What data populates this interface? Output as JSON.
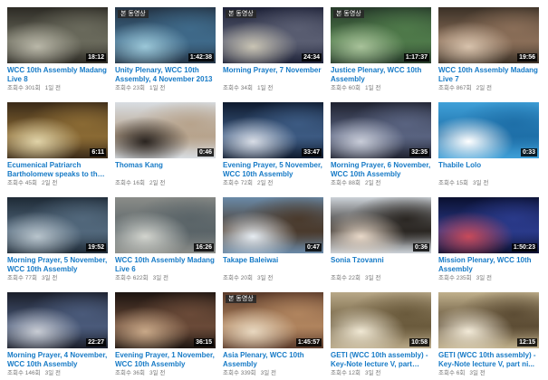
{
  "videos": [
    {
      "title": "WCC 10th Assembly Madang Live 8",
      "duration": "18:12",
      "views": "조회수 301회",
      "age": "1일 전",
      "badge": "",
      "palette": [
        "#2c2a24",
        "#6a6a5c",
        "#b9b7a8"
      ]
    },
    {
      "title": "Unity Plenary, WCC 10th Assembly, 4 November 2013",
      "duration": "1:42:38",
      "views": "조회수 23회",
      "age": "1일 전",
      "badge": "본 동영상",
      "palette": [
        "#243445",
        "#3f6a8a",
        "#9bc7d8"
      ]
    },
    {
      "title": "Morning Prayer, 7 November",
      "duration": "24:34",
      "views": "조회수 34회",
      "age": "1일 전",
      "badge": "본 동영상",
      "palette": [
        "#1e2238",
        "#5a5e72",
        "#c9c4b4"
      ]
    },
    {
      "title": "Justice Plenary, WCC 10th Assembly",
      "duration": "1:17:37",
      "views": "조회수 60회",
      "age": "1일 전",
      "badge": "본 동영상",
      "palette": [
        "#263a2a",
        "#4f7a4a",
        "#a8c29a"
      ]
    },
    {
      "title": "WCC 10th Assembly Madang Live 7",
      "duration": "19:56",
      "views": "조회수 867회",
      "age": "2일 전",
      "badge": "",
      "palette": [
        "#3a3026",
        "#8a6e58",
        "#d7c2ac"
      ]
    },
    {
      "title": "Ecumenical Patriarch Bartholomew speaks to the ...",
      "duration": "6:11",
      "views": "조회수 45회",
      "age": "2일 전",
      "badge": "",
      "palette": [
        "#3a2a18",
        "#8a6a34",
        "#e0d3a8"
      ]
    },
    {
      "title": "Thomas Kang",
      "duration": "0:46",
      "views": "조회수 16회",
      "age": "2일 전",
      "badge": "",
      "palette": [
        "#d8dde2",
        "#b7a38c",
        "#2a2420"
      ]
    },
    {
      "title": "Evening Prayer, 5 November, WCC 10th Assembly",
      "duration": "33:47",
      "views": "조회수 72회",
      "age": "2일 전",
      "badge": "",
      "palette": [
        "#0e1a2e",
        "#3c5a82",
        "#d8dde6"
      ]
    },
    {
      "title": "Morning Prayer, 6 November, WCC 10th Assembly",
      "duration": "32:35",
      "views": "조회수 88회",
      "age": "2일 전",
      "badge": "",
      "palette": [
        "#1f2230",
        "#596380",
        "#c8ccd8"
      ]
    },
    {
      "title": "Thabile Lolo",
      "duration": "0:33",
      "views": "조회수 15회",
      "age": "3일 전",
      "badge": "",
      "palette": [
        "#3fa0d8",
        "#1e6fa8",
        "#ffffff"
      ]
    },
    {
      "title": "Morning Prayer, 5 November, WCC 10th Assembly",
      "duration": "19:52",
      "views": "조회수 77회",
      "age": "3일 전",
      "badge": "",
      "palette": [
        "#1e2a36",
        "#52687c",
        "#b8c4cc"
      ]
    },
    {
      "title": "WCC 10th Assembly Madang Live 6",
      "duration": "16:26",
      "views": "조회수 622회",
      "age": "3일 전",
      "badge": "",
      "palette": [
        "#8a8c88",
        "#5a6468",
        "#d2d4ce"
      ]
    },
    {
      "title": "Takape Baleiwai",
      "duration": "0:47",
      "views": "조회수 20회",
      "age": "3일 전",
      "badge": "",
      "palette": [
        "#6a8aa8",
        "#4a3a2c",
        "#e6ecf2"
      ]
    },
    {
      "title": "Sonia Tzovanni",
      "duration": "0:36",
      "views": "조회수 22회",
      "age": "3일 전",
      "badge": "",
      "palette": [
        "#ccd2d8",
        "#2a2622",
        "#e8d8c8"
      ]
    },
    {
      "title": "Mission Plenary, WCC 10th Assembly",
      "duration": "1:50:23",
      "views": "조회수 235회",
      "age": "3일 전",
      "badge": "",
      "palette": [
        "#0a1030",
        "#2a3a8a",
        "#c84a5a"
      ]
    },
    {
      "title": "Morning Prayer, 4 November, WCC 10th Assembly",
      "duration": "22:27",
      "views": "조회수 146회",
      "age": "3일 전",
      "badge": "",
      "palette": [
        "#1a1e2a",
        "#4a5a7a",
        "#c8ccd4"
      ]
    },
    {
      "title": "Evening Prayer, 1 November, WCC 10th Assembly",
      "duration": "36:15",
      "views": "조회수 36회",
      "age": "3일 전",
      "badge": "",
      "palette": [
        "#1c1410",
        "#6a4a38",
        "#c8a888"
      ]
    },
    {
      "title": "Asia Plenary, WCC 10th Assembly",
      "duration": "1:45:57",
      "views": "조회수 339회",
      "age": "3일 전",
      "badge": "본 동영상",
      "palette": [
        "#5a3a2a",
        "#b0845e",
        "#e8d8c0"
      ]
    },
    {
      "title": "GETI (WCC 10th assembly) - Key-Note lecture V, part five...",
      "duration": "10:58",
      "views": "조회수 12회",
      "age": "3일 전",
      "badge": "",
      "palette": [
        "#b8a888",
        "#6a5a3c",
        "#f0e8d4"
      ]
    },
    {
      "title": "GETI (WCC 10th assembly) - Key-Note lecture V, part ni...",
      "duration": "12:15",
      "views": "조회수 6회",
      "age": "3일 전",
      "badge": "",
      "palette": [
        "#c0b08c",
        "#5c4c34",
        "#f2ead8"
      ]
    }
  ]
}
